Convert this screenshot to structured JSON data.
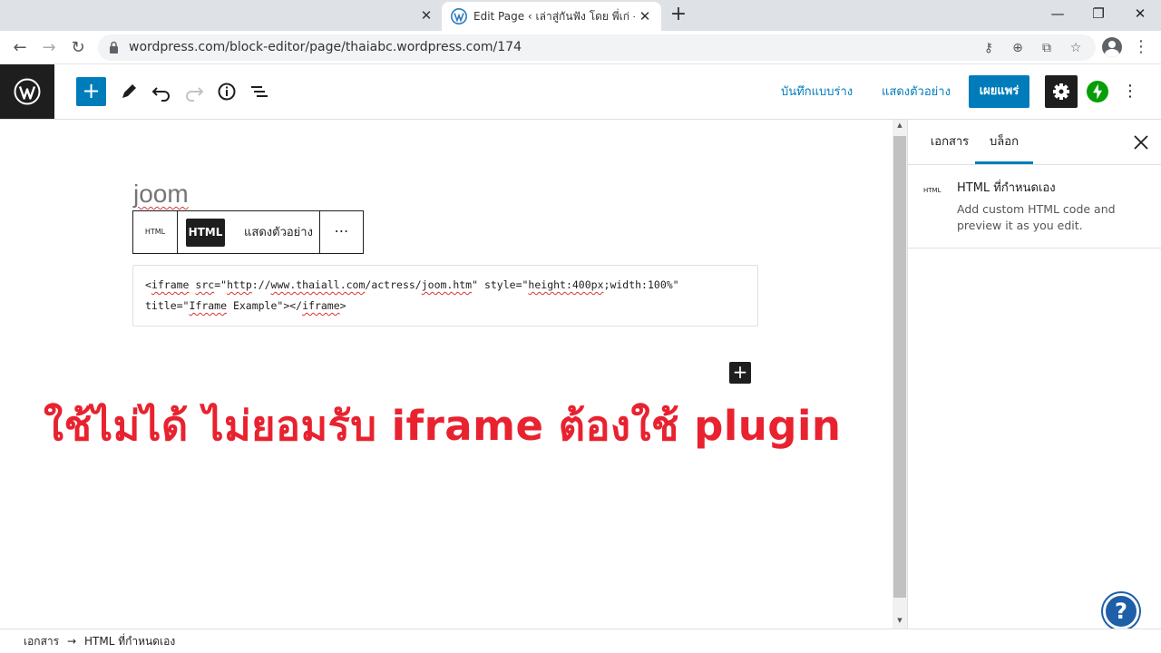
{
  "browser": {
    "tab_title": "Edit Page ‹ เล่าสู่กันฟัง โดย พี่เก่ — WordPress.com",
    "url": "wordpress.com/block-editor/page/thaiabc.wordpress.com/174"
  },
  "editor": {
    "toolbar": {
      "save_draft_label": "บันทึกแบบร่าง",
      "preview_label": "แสดงตัวอย่าง",
      "publish_label": "เผยแพร่"
    },
    "page_title": "joom",
    "block_toolbar": {
      "html_icon_label": "HTML",
      "html_tab_label": "HTML",
      "preview_tab_label": "แสดงตัวอย่าง",
      "more_label": "⋯"
    },
    "code": {
      "line1": {
        "t1": "<",
        "t2": "iframe",
        "t3": " ",
        "t4": "src",
        "t5": "=\"",
        "t6": "http",
        "t7": "://",
        "t8": "www.thaiall.com",
        "t9": "/actress/",
        "t10": "joom.htm",
        "t11": "\" style=\"",
        "t12": "height:400px",
        "t13": ";width:100%\""
      },
      "line2": {
        "t1": "title=\"",
        "t2": "Iframe",
        "t3": " Example\"></",
        "t4": "iframe",
        "t5": ">"
      }
    },
    "annotation": "ใช้ไม่ได้ ไม่ยอมรับ iframe ต้องใช้ plugin"
  },
  "sidebar": {
    "tab_document": "เอกสาร",
    "tab_block": "บล็อก",
    "block_card": {
      "icon_label": "HTML",
      "title": "HTML ที่กำหนดเอง",
      "description": "Add custom HTML code and preview it as you edit."
    }
  },
  "footer": {
    "crumb_document": "เอกสาร",
    "separator": "→",
    "crumb_block": "HTML ที่กำหนดเอง"
  },
  "icons": {
    "tab_close": "close-icon",
    "new_tab": "plus-icon",
    "lock": "lock-icon",
    "wp_logo": "wordpress-logo-icon",
    "settings": "gear-icon",
    "jetpack": "jetpack-bolt-icon",
    "help": "help-question-icon"
  },
  "colors": {
    "accent": "#007cba",
    "annotation": "#e8222f",
    "dark": "#1e1e1e"
  }
}
